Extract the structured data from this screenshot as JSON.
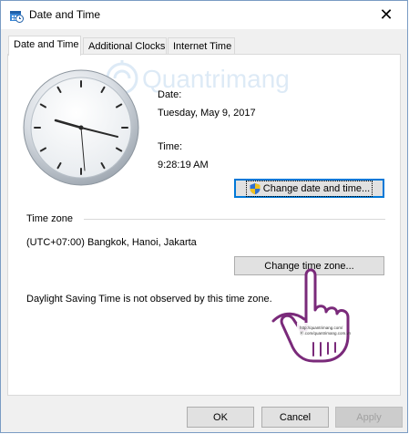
{
  "window": {
    "title": "Date and Time",
    "close_glyph": "✕"
  },
  "tabs": [
    {
      "label": "Date and Time",
      "active": true
    },
    {
      "label": "Additional Clocks",
      "active": false
    },
    {
      "label": "Internet Time",
      "active": false
    }
  ],
  "datetime": {
    "date_label": "Date:",
    "date_value": "Tuesday, May 9, 2017",
    "time_label": "Time:",
    "time_value": "9:28:19 AM",
    "change_button": "Change date and time..."
  },
  "timezone": {
    "section_label": "Time zone",
    "value": "(UTC+07:00) Bangkok, Hanoi, Jakarta",
    "change_button": "Change time zone...",
    "dst_note": "Daylight Saving Time is not observed by this time zone."
  },
  "footer": {
    "ok": "OK",
    "cancel": "Cancel",
    "apply": "Apply"
  },
  "watermark": {
    "text": "Quantrimang",
    "url1": "http://quantrimang.com/",
    "url2": "Ⓡ.com/quantrimang.com.vn"
  },
  "icons": {
    "window_icon": "clock-calendar-icon",
    "shield": "uac-shield-icon",
    "pointer": "hand-pointer-icon"
  }
}
